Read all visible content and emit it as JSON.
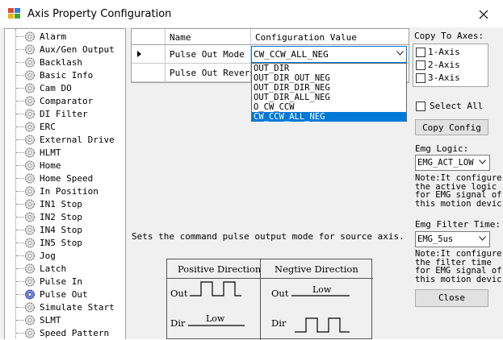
{
  "window": {
    "title": "Axis Property Configuration"
  },
  "tree": {
    "items": [
      {
        "label": "Alarm"
      },
      {
        "label": "Aux/Gen Output"
      },
      {
        "label": "Backlash"
      },
      {
        "label": "Basic Info"
      },
      {
        "label": "Cam DO"
      },
      {
        "label": "Comparator"
      },
      {
        "label": "DI Filter"
      },
      {
        "label": "ERC"
      },
      {
        "label": "External Drive"
      },
      {
        "label": "HLMT"
      },
      {
        "label": "Home"
      },
      {
        "label": "Home Speed"
      },
      {
        "label": "In Position"
      },
      {
        "label": "IN1 Stop"
      },
      {
        "label": "IN2 Stop"
      },
      {
        "label": "IN4 Stop"
      },
      {
        "label": "IN5 Stop"
      },
      {
        "label": "Jog"
      },
      {
        "label": "Latch"
      },
      {
        "label": "Pulse In"
      },
      {
        "label": "Pulse Out",
        "selected": true
      },
      {
        "label": "Simulate Start"
      },
      {
        "label": "SLMT"
      },
      {
        "label": "Speed Pattern"
      }
    ]
  },
  "grid": {
    "col_name": "Name",
    "col_value": "Configuration Value",
    "rows": [
      {
        "name": "Pulse Out Mode",
        "value": "CW_CCW_ALL_NEG"
      },
      {
        "name": "Pulse Out Reverse",
        "value": ""
      }
    ]
  },
  "dropdown": {
    "options": [
      "OUT_DIR",
      "OUT_DIR_OUT_NEG",
      "OUT_DIR_DIR_NEG",
      "OUT_DIR_ALL_NEG",
      "O_CW_CCW",
      "CW_CCW_ALL_NEG"
    ],
    "selected": "CW_CCW_ALL_NEG"
  },
  "description": "Sets the command pulse output mode for source axis.",
  "pulse_diagram": {
    "header_positive": "Positive Direction",
    "header_negative": "Negtive Direction",
    "out_label": "Out",
    "dir_label": "Dir",
    "low_text": "Low"
  },
  "copy_axes": {
    "label": "Copy To Axes:",
    "axes": [
      "1-Axis",
      "2-Axis",
      "3-Axis"
    ],
    "select_all": "Select All",
    "copy_button": "Copy Config"
  },
  "emg_logic": {
    "label": "Emg Logic:",
    "value": "EMG_ACT_LOW",
    "note": "Note:It configure\nthe active logic\nfor EMG signal of\nthis motion devic"
  },
  "emg_filter": {
    "label": "Emg Filter Time:",
    "value": "EMG_5us",
    "note": "Note:It configure\nthe filter time\nfor EMG signal of\nthis motion devic"
  },
  "close_button": "Close",
  "colors": {
    "accent": "#0078d7"
  }
}
